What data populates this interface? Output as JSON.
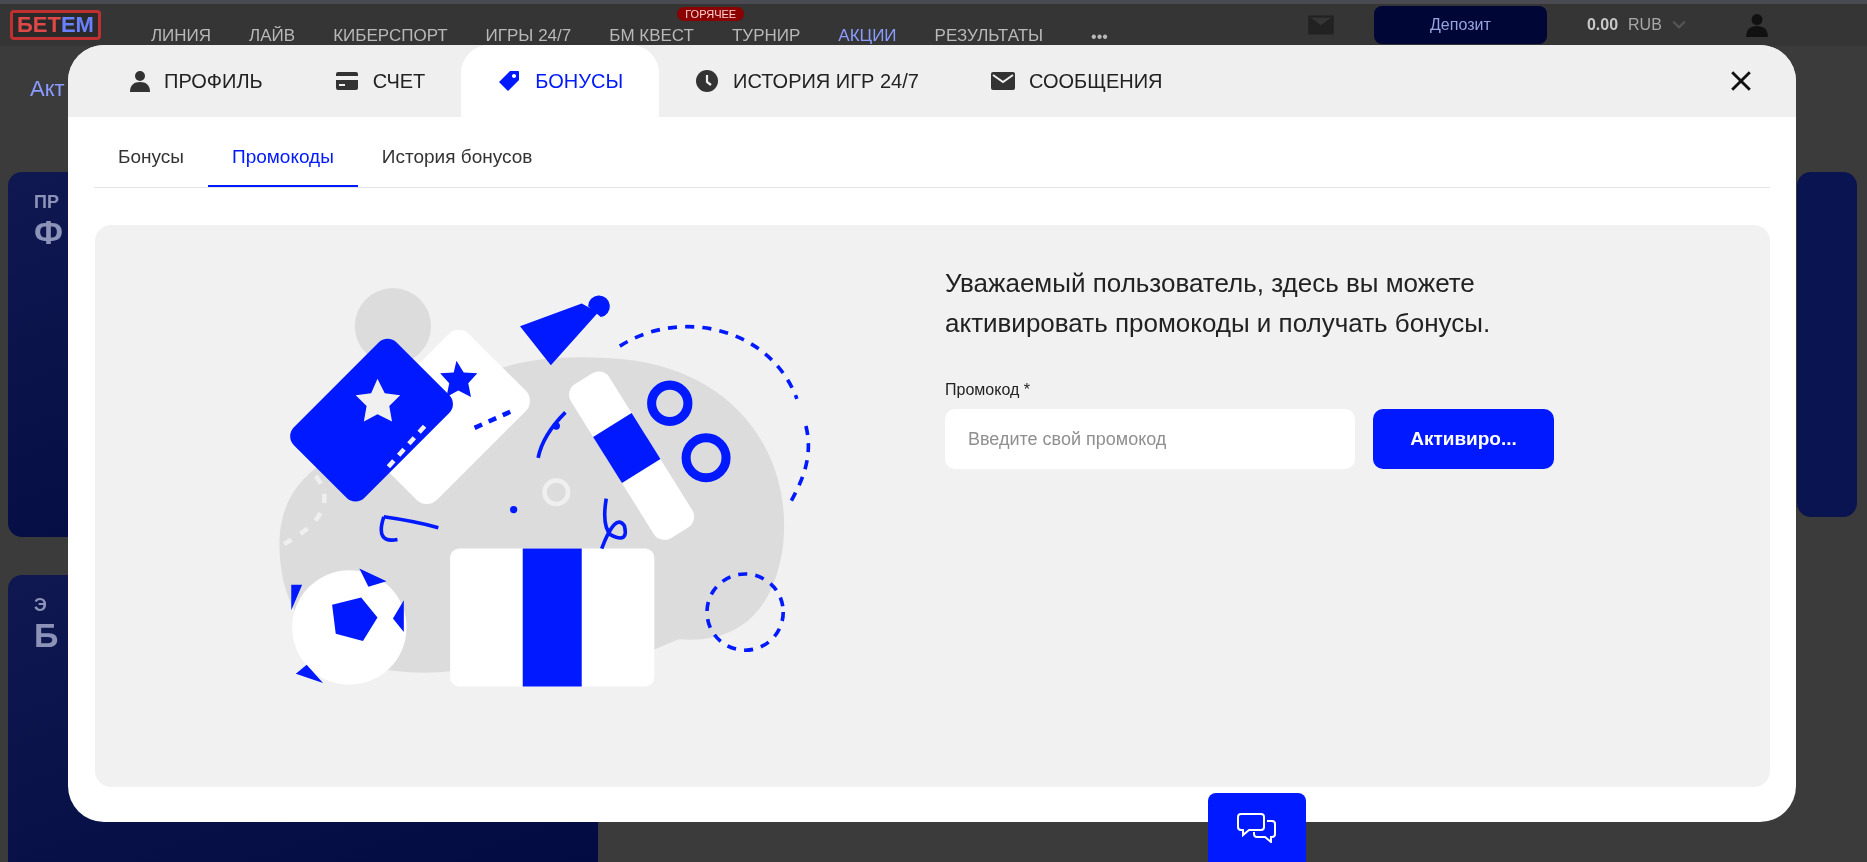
{
  "page": {
    "logo": [
      "БЕТ",
      "ЕМ"
    ],
    "nav": [
      {
        "label": "ЛИНИЯ",
        "selected": false
      },
      {
        "label": "ЛАЙВ",
        "selected": false
      },
      {
        "label": "КИБЕРСПОРТ",
        "selected": false
      },
      {
        "label": "ИГРЫ 24/7",
        "selected": false
      },
      {
        "label": "БМ КВЕСТ",
        "selected": false,
        "badge": "ГОРЯЧЕЕ"
      },
      {
        "label": "ТУРНИР",
        "selected": false
      },
      {
        "label": "АКЦИИ",
        "selected": true
      },
      {
        "label": "РЕЗУЛЬТАТЫ",
        "selected": false
      }
    ],
    "more": "•••",
    "deposit_button": "Депозит",
    "balance": "0.00",
    "currency": "RUB",
    "heading": "Акт",
    "cards": [
      {
        "lines": [
          "ПР",
          "Ф"
        ]
      },
      {
        "lines": [
          "Э",
          "Б"
        ]
      }
    ]
  },
  "modal": {
    "tabs": [
      {
        "label": "ПРОФИЛЬ",
        "selected": false
      },
      {
        "label": "СЧЕТ",
        "selected": false
      },
      {
        "label": "БОНУСЫ",
        "selected": true
      },
      {
        "label": "ИСТОРИЯ ИГР 24/7",
        "selected": false
      },
      {
        "label": "СООБЩЕНИЯ",
        "selected": false
      }
    ],
    "subtabs": [
      {
        "label": "Бонусы",
        "selected": false
      },
      {
        "label": "Промокоды",
        "selected": true
      },
      {
        "label": "История бонусов",
        "selected": false
      }
    ],
    "description": "Уважаемый пользователь, здесь вы можете активировать промокоды и получать бонусы.",
    "promo_field": {
      "label": "Промокод *",
      "placeholder": "Введите свой промокод"
    },
    "activate_button": "Активиро..."
  }
}
